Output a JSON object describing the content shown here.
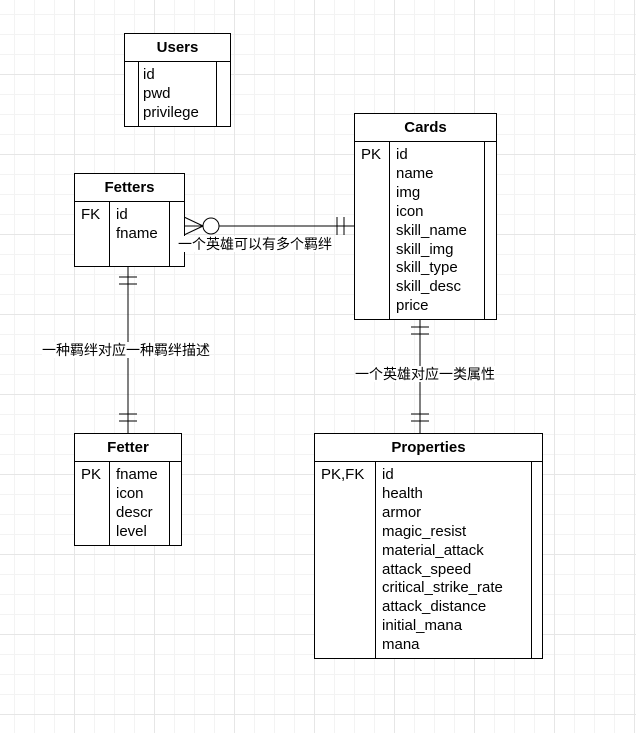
{
  "entities": {
    "users": {
      "title": "Users",
      "key": "",
      "attributes": [
        "id",
        "pwd",
        "privilege"
      ]
    },
    "cards": {
      "title": "Cards",
      "key": "PK",
      "attributes": [
        "id",
        "name",
        "img",
        "icon",
        "skill_name",
        "skill_img",
        "skill_type",
        "skill_desc",
        "price"
      ]
    },
    "fetters": {
      "title": "Fetters",
      "key": "FK",
      "attributes": [
        "id",
        "fname"
      ]
    },
    "fetter": {
      "title": "Fetter",
      "key": "PK",
      "attributes": [
        "fname",
        "icon",
        "descr",
        "level"
      ]
    },
    "properties": {
      "title": "Properties",
      "key": "PK,FK",
      "attributes": [
        "id",
        "health",
        "armor",
        "magic_resist",
        "material_attack",
        "attack_speed",
        "critical_strike_rate",
        "attack_distance",
        "initial_mana",
        "mana"
      ]
    }
  },
  "relationships": {
    "cards_fetters": "一个英雄可以有多个羁绊",
    "fetters_fetter": "一种羁绊对应一种羁绊描述",
    "cards_properties": "一个英雄对应一类属性"
  }
}
